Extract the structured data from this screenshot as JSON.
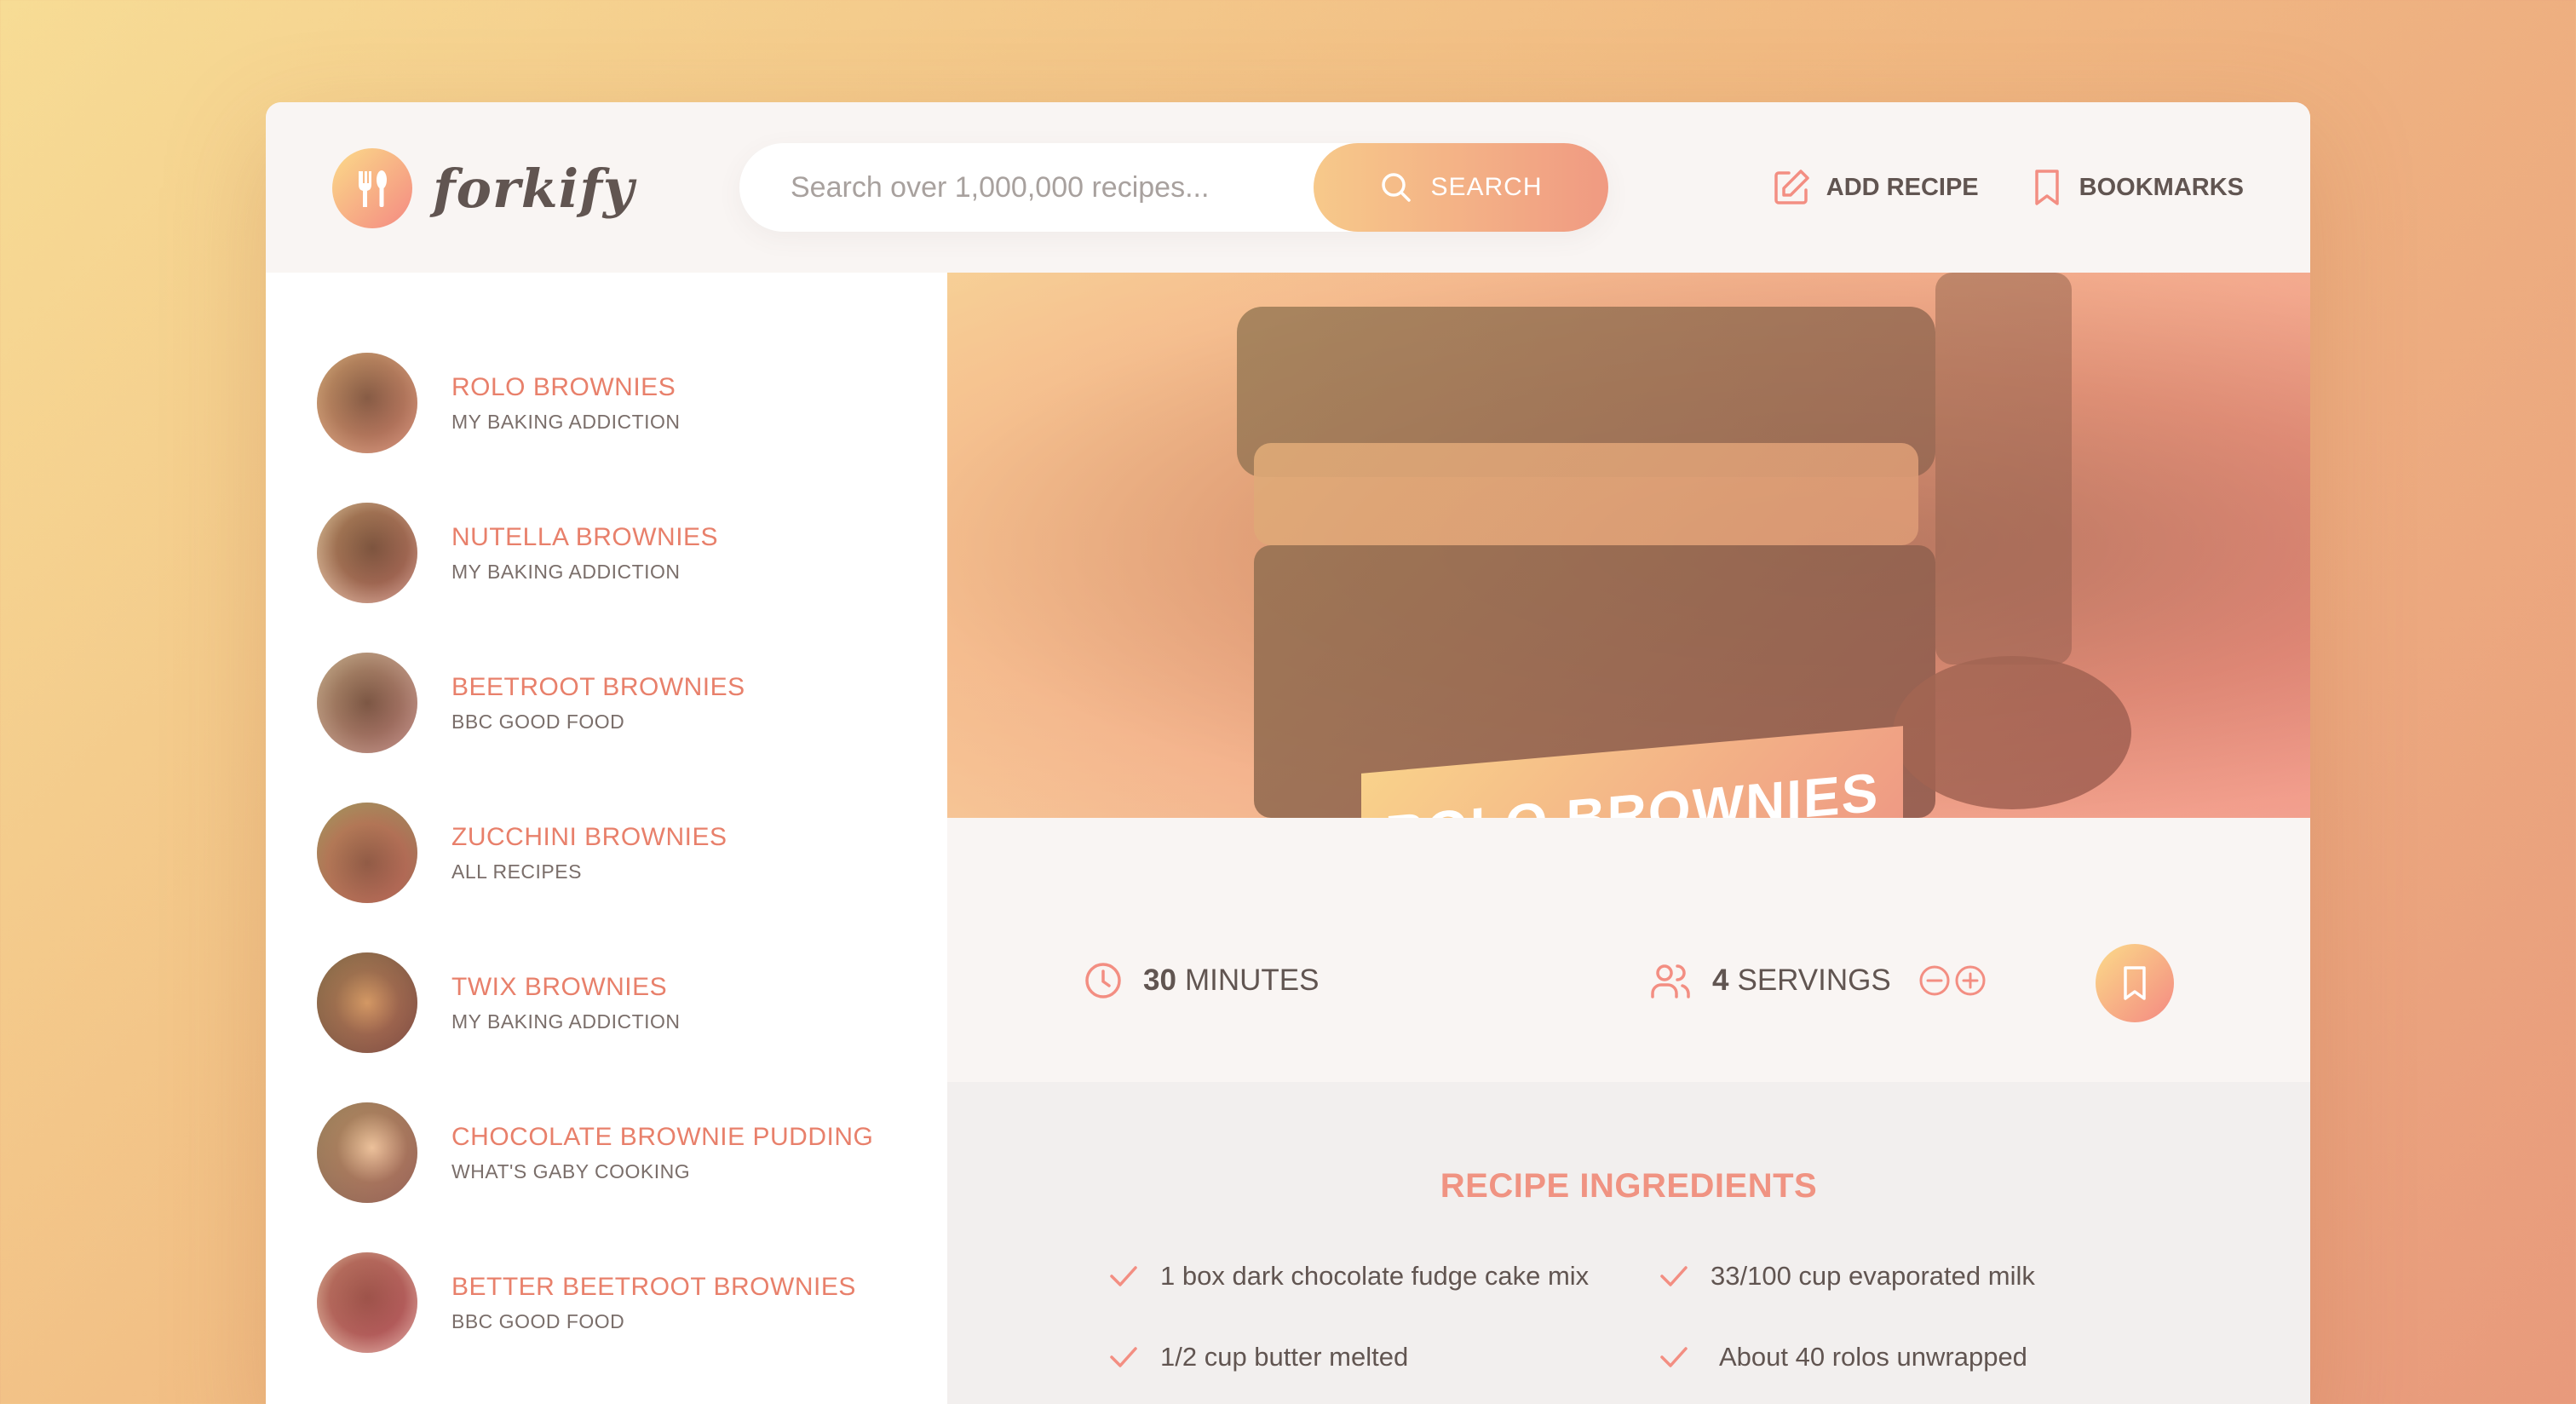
{
  "header": {
    "logo_text": "forkify",
    "search_placeholder": "Search over 1,000,000 recipes...",
    "search_button": "SEARCH",
    "nav": {
      "add_recipe": "ADD RECIPE",
      "bookmarks": "BOOKMARKS"
    }
  },
  "results": [
    {
      "title": "ROLO BROWNIES",
      "publisher": "MY BAKING ADDICTION"
    },
    {
      "title": "NUTELLA BROWNIES",
      "publisher": "MY BAKING ADDICTION"
    },
    {
      "title": "BEETROOT BROWNIES",
      "publisher": "BBC GOOD FOOD"
    },
    {
      "title": "ZUCCHINI BROWNIES",
      "publisher": "ALL RECIPES"
    },
    {
      "title": "TWIX BROWNIES",
      "publisher": "MY BAKING ADDICTION"
    },
    {
      "title": "CHOCOLATE BROWNIE PUDDING",
      "publisher": "WHAT'S GABY COOKING"
    },
    {
      "title": "BETTER BEETROOT BROWNIES",
      "publisher": "BBC GOOD FOOD"
    }
  ],
  "recipe": {
    "title": "ROLO BROWNIES",
    "minutes": "30",
    "minutes_label": "MINUTES",
    "servings": "4",
    "servings_label": "SERVINGS",
    "ingredients_heading": "RECIPE INGREDIENTS",
    "ingredients": [
      "1 box dark chocolate fudge cake mix",
      "33/100 cup evaporated milk",
      "1/2 cup butter melted",
      "About 40 rolos unwrapped"
    ]
  },
  "colors": {
    "accent": "#f38e82",
    "accent_light": "#fbdb89",
    "text": "#615551",
    "background": "#f9f5f3"
  }
}
